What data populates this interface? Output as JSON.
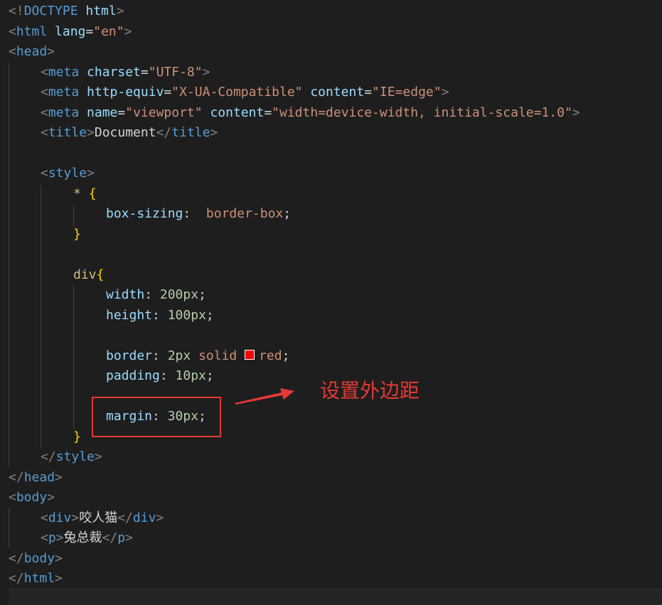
{
  "lines": {
    "l1": {
      "a": "<!",
      "b": "DOCTYPE",
      "c": " html",
      "d": ">"
    },
    "l2": {
      "a": "<",
      "b": "html",
      "c": " lang",
      "d": "=",
      "e": "\"en\"",
      "f": ">"
    },
    "l3": {
      "a": "<",
      "b": "head",
      "c": ">"
    },
    "l4": {
      "a": "<",
      "b": "meta",
      "c": " charset",
      "d": "=",
      "e": "\"UTF-8\"",
      "f": ">"
    },
    "l5": {
      "a": "<",
      "b": "meta",
      "c": " http-equiv",
      "d": "=",
      "e": "\"X-UA-Compatible\"",
      "f": " content",
      "g": "=",
      "h": "\"IE=edge\"",
      "i": ">"
    },
    "l6": {
      "a": "<",
      "b": "meta",
      "c": " name",
      "d": "=",
      "e": "\"viewport\"",
      "f": " content",
      "g": "=",
      "h": "\"width=device-width, initial-scale=1.0\"",
      "i": ">"
    },
    "l7": {
      "a": "<",
      "b": "title",
      "c": ">",
      "d": "Document",
      "e": "</",
      "f": "title",
      "g": ">"
    },
    "l8": {
      "a": "<",
      "b": "style",
      "c": ">"
    },
    "l9": {
      "a": "* ",
      "b": "{"
    },
    "l10": {
      "a": "box-sizing",
      "b": ":  ",
      "c": "border-box",
      "d": ";"
    },
    "l11": {
      "a": "}"
    },
    "l12": {
      "a": "div",
      "b": "{"
    },
    "l13": {
      "a": "width",
      "b": ": ",
      "c": "200px",
      "d": ";"
    },
    "l14": {
      "a": "height",
      "b": ": ",
      "c": "100px",
      "d": ";"
    },
    "l15": {
      "a": "border",
      "b": ": ",
      "c": "2px",
      "d": " solid ",
      "e": "red",
      "f": ";"
    },
    "l16": {
      "a": "padding",
      "b": ": ",
      "c": "10px",
      "d": ";"
    },
    "l17": {
      "a": "margin",
      "b": ": ",
      "c": "30px",
      "d": ";"
    },
    "l18": {
      "a": "}"
    },
    "l19": {
      "a": "</",
      "b": "style",
      "c": ">"
    },
    "l20": {
      "a": "</",
      "b": "head",
      "c": ">"
    },
    "l21": {
      "a": "<",
      "b": "body",
      "c": ">"
    },
    "l22": {
      "a": "<",
      "b": "div",
      "c": ">",
      "d": "咬人猫",
      "e": "</",
      "f": "div",
      "g": ">"
    },
    "l23": {
      "a": "<",
      "b": "p",
      "c": ">",
      "d": "兔总裁",
      "e": "</",
      "f": "p",
      "g": ">"
    },
    "l24": {
      "a": "</",
      "b": "body",
      "c": ">"
    },
    "l25": {
      "a": "</",
      "b": "html",
      "c": ">"
    }
  },
  "annotation": {
    "text": "设置外边距"
  },
  "colors": {
    "accent": "#e53935",
    "swatch": "#ff0000"
  }
}
